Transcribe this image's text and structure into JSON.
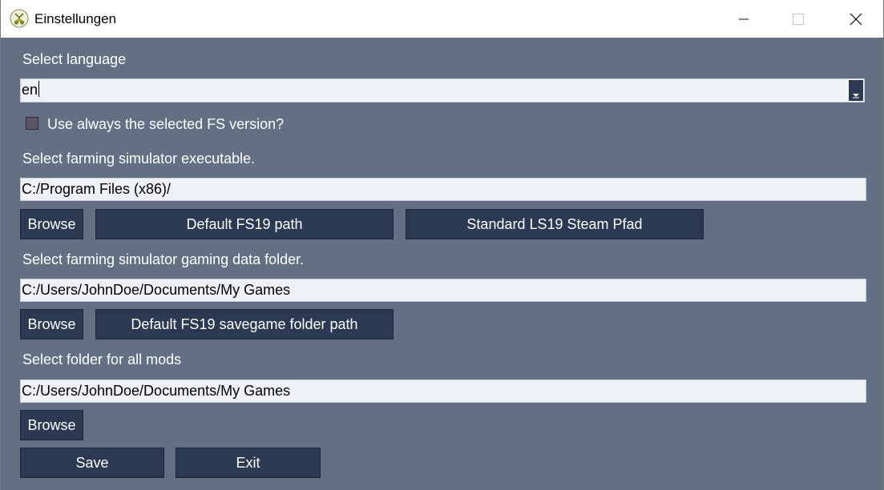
{
  "window": {
    "title": "Einstellungen",
    "app_icon": "farming-tractor-icon",
    "controls": {
      "minimize": "minimize-icon",
      "maximize": "maximize-icon",
      "close": "close-icon"
    }
  },
  "language": {
    "label": "Select language",
    "value": "en",
    "dropdown_icon": "dropdown-arrow-icon"
  },
  "fs_version": {
    "label": "Use always the selected FS version?",
    "checked": false
  },
  "executable": {
    "label": "Select farming simulator executable.",
    "path": "C:/Program Files (x86)/",
    "browse_label": "Browse",
    "default_label": "Default FS19 path",
    "steam_label": "Standard LS19 Steam Pfad"
  },
  "gaming_data": {
    "label": "Select farming simulator gaming data folder.",
    "path": "C:/Users/JohnDoe/Documents/My Games",
    "browse_label": "Browse",
    "default_label": "Default FS19 savegame folder path"
  },
  "mods": {
    "label": "Select folder for all mods",
    "path": "C:/Users/JohnDoe/Documents/My Games",
    "browse_label": "Browse"
  },
  "actions": {
    "save_label": "Save",
    "exit_label": "Exit"
  },
  "colors": {
    "background": "#637083",
    "button": "#2b3a52",
    "field": "#eef1f6"
  }
}
